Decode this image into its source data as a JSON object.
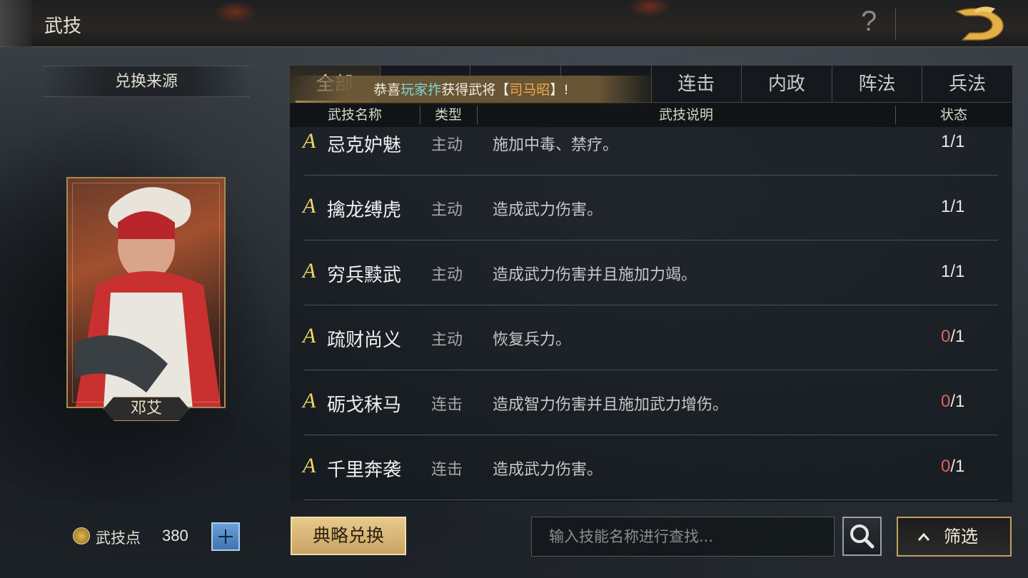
{
  "header": {
    "title": "武技"
  },
  "sidebar": {
    "source_label": "兑换来源",
    "general_name": "邓艾",
    "points_label": "武技点",
    "points_value": "380"
  },
  "tabs": [
    {
      "label": "全部",
      "active": true
    },
    {
      "label": "",
      "active": false
    },
    {
      "label": "",
      "active": false
    },
    {
      "label": "",
      "active": false
    },
    {
      "label": "连击",
      "active": false
    },
    {
      "label": "内政",
      "active": false
    },
    {
      "label": "阵法",
      "active": false
    },
    {
      "label": "兵法",
      "active": false
    }
  ],
  "notification": {
    "prefix": "恭喜",
    "player": "玩家拃",
    "middle": "获得武将【",
    "general": "司马昭",
    "suffix": "】!"
  },
  "columns": {
    "name": "武技名称",
    "type": "类型",
    "desc": "武技说明",
    "status": "状态"
  },
  "skills": [
    {
      "grade": "A",
      "name": "忌克妒魅",
      "type": "主动",
      "desc": "施加中毒、禁疗。",
      "current": "1",
      "total": "1"
    },
    {
      "grade": "A",
      "name": "擒龙缚虎",
      "type": "主动",
      "desc": "造成武力伤害。",
      "current": "1",
      "total": "1"
    },
    {
      "grade": "A",
      "name": "穷兵黩武",
      "type": "主动",
      "desc": "造成武力伤害并且施加力竭。",
      "current": "1",
      "total": "1"
    },
    {
      "grade": "A",
      "name": "疏财尚义",
      "type": "主动",
      "desc": "恢复兵力。",
      "current": "0",
      "total": "1"
    },
    {
      "grade": "A",
      "name": "砺戈秣马",
      "type": "连击",
      "desc": "造成智力伤害并且施加武力增伤。",
      "current": "0",
      "total": "1"
    },
    {
      "grade": "A",
      "name": "千里奔袭",
      "type": "连击",
      "desc": "造成武力伤害。",
      "current": "0",
      "total": "1"
    }
  ],
  "bottom": {
    "exchange_label": "典略兑换",
    "search_placeholder": "输入技能名称进行查找...",
    "filter_label": "筛选"
  },
  "icons": {
    "help": "question-icon",
    "logo": "dragon-logo-icon",
    "search": "magnifier-icon",
    "add": "plus-icon",
    "filter": "chevron-up-icon",
    "points": "coin-icon"
  },
  "colors": {
    "accent_gold": "#c9a860",
    "grade": "#f1d564",
    "zero_count": "#e06060",
    "notify_player": "#7fd7d6",
    "notify_general": "#f1a84e"
  }
}
